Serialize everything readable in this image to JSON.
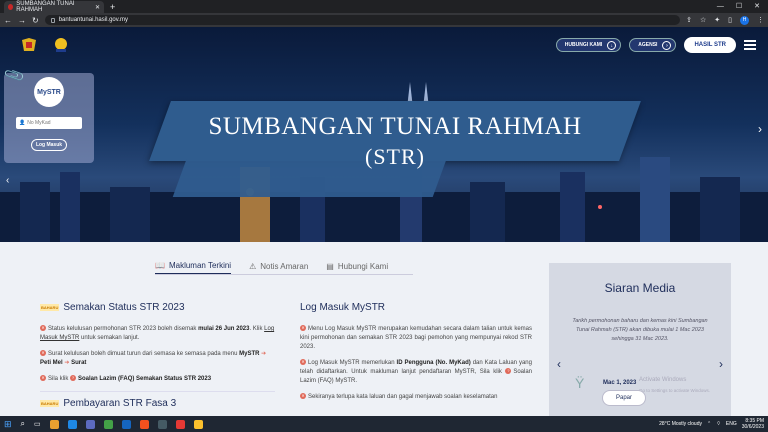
{
  "browser": {
    "tab_title": "SUMBANGAN TUNAI RAHMAH",
    "url": "bantuantunai.hasil.gov.my"
  },
  "header": {
    "nav": [
      "HUBUNGI KAMI",
      "AGENSI"
    ],
    "hasil_button": "HASIL STR"
  },
  "hero": {
    "title_line1": "SUMBANGAN TUNAI RAHMAH",
    "title_line2": "(STR)"
  },
  "login": {
    "logo_text": "MySTR",
    "mykad_placeholder": "No MyKad",
    "button": "Log Masuk"
  },
  "tabs": [
    {
      "label": "Makluman Terkini",
      "icon": "book-icon"
    },
    {
      "label": "Notis Amaran",
      "icon": "alert-icon"
    },
    {
      "label": "Hubungi Kami",
      "icon": "chart-icon"
    }
  ],
  "col1": {
    "badge": "BAHARU",
    "title": "Semakan Status STR 2023",
    "p1_a": "Status kelulusan permohonan STR 2023 boleh disemak ",
    "p1_b": "mulai 26 Jun 2023",
    "p1_c": ". Klik ",
    "p1_link": "Log Masuk MySTR",
    "p1_d": " untuk semakan lanjut.",
    "p2_a": "Surat kelulusan boleh dimuat turun dari semasa ke semasa pada menu ",
    "p2_b": "MySTR",
    "p2_c": "Peti Mel",
    "p2_d": "Surat",
    "p3_a": "Sila klik ",
    "p3_b": "Soalan Lazim (FAQ) Semakan Status STR 2023",
    "badge2": "BAHARU",
    "title2": "Pembayaran STR Fasa 3"
  },
  "col2": {
    "title": "Log Masuk MySTR",
    "p1": "Menu Log Masuk MySTR merupakan kemudahan secara dalam talian untuk kemas kini permohonan dan semakan STR 2023 bagi pemohon yang mempunyai rekod STR 2023.",
    "p2_a": "Log Masuk MySTR memerlukan ",
    "p2_b": "ID Pengguna (No. MyKad)",
    "p2_c": " dan Kata Laluan yang telah didaftarkan. Untuk makluman lanjut pendaftaran MySTR, Sila klik ",
    "p2_d": "Soalan Lazim (FAQ)",
    "p2_e": " MySTR.",
    "p3": "Sekiranya terlupa kata laluan dan gagal menjawab soalan keselamatan"
  },
  "siaran": {
    "title": "Siaran Media",
    "quote": "Tarikh permohonan baharu dan kemas kini Sumbangan Tunai Rahmah (STR) akan dibuka mulai 1 Mac 2023 sehingga 31 Mac 2023.",
    "date": "Mac 1, 2023",
    "button": "Papar",
    "watermark1": "Activate Windows",
    "watermark2": "Go to Settings to activate Windows."
  },
  "taskbar": {
    "weather": "28°C  Mostly cloudy",
    "lang": "ENG",
    "time": "8:35 PM",
    "date": "30/6/2023"
  }
}
